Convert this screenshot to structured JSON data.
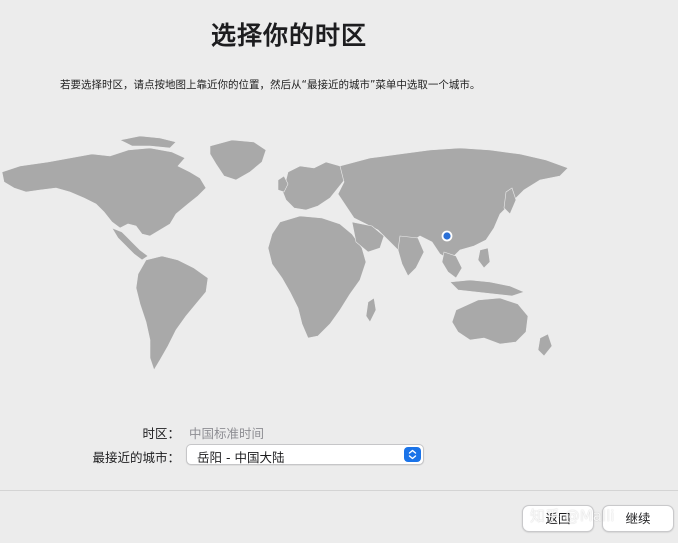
{
  "header": {
    "title": "选择你的时区",
    "instruction": "若要选择时区，请点按地图上靠近你的位置，然后从“最接近的城市”菜单中选取一个城市。"
  },
  "timezone": {
    "label": "时区：",
    "value": "中国标准时间"
  },
  "closest_city": {
    "label": "最接近的城市：",
    "selected": "岳阳 - 中国大陆"
  },
  "buttons": {
    "back": "返回",
    "continue": "继续"
  },
  "watermark": {
    "text": "知乎 @Malli"
  },
  "colors": {
    "background": "#ececec",
    "land": "#a9a9a9",
    "location_marker": "#2a6fd6",
    "select_accent": "#1a73e8"
  },
  "icons": {
    "location_marker": "location-pin-icon",
    "select_arrow": "chevron-updown-icon"
  }
}
